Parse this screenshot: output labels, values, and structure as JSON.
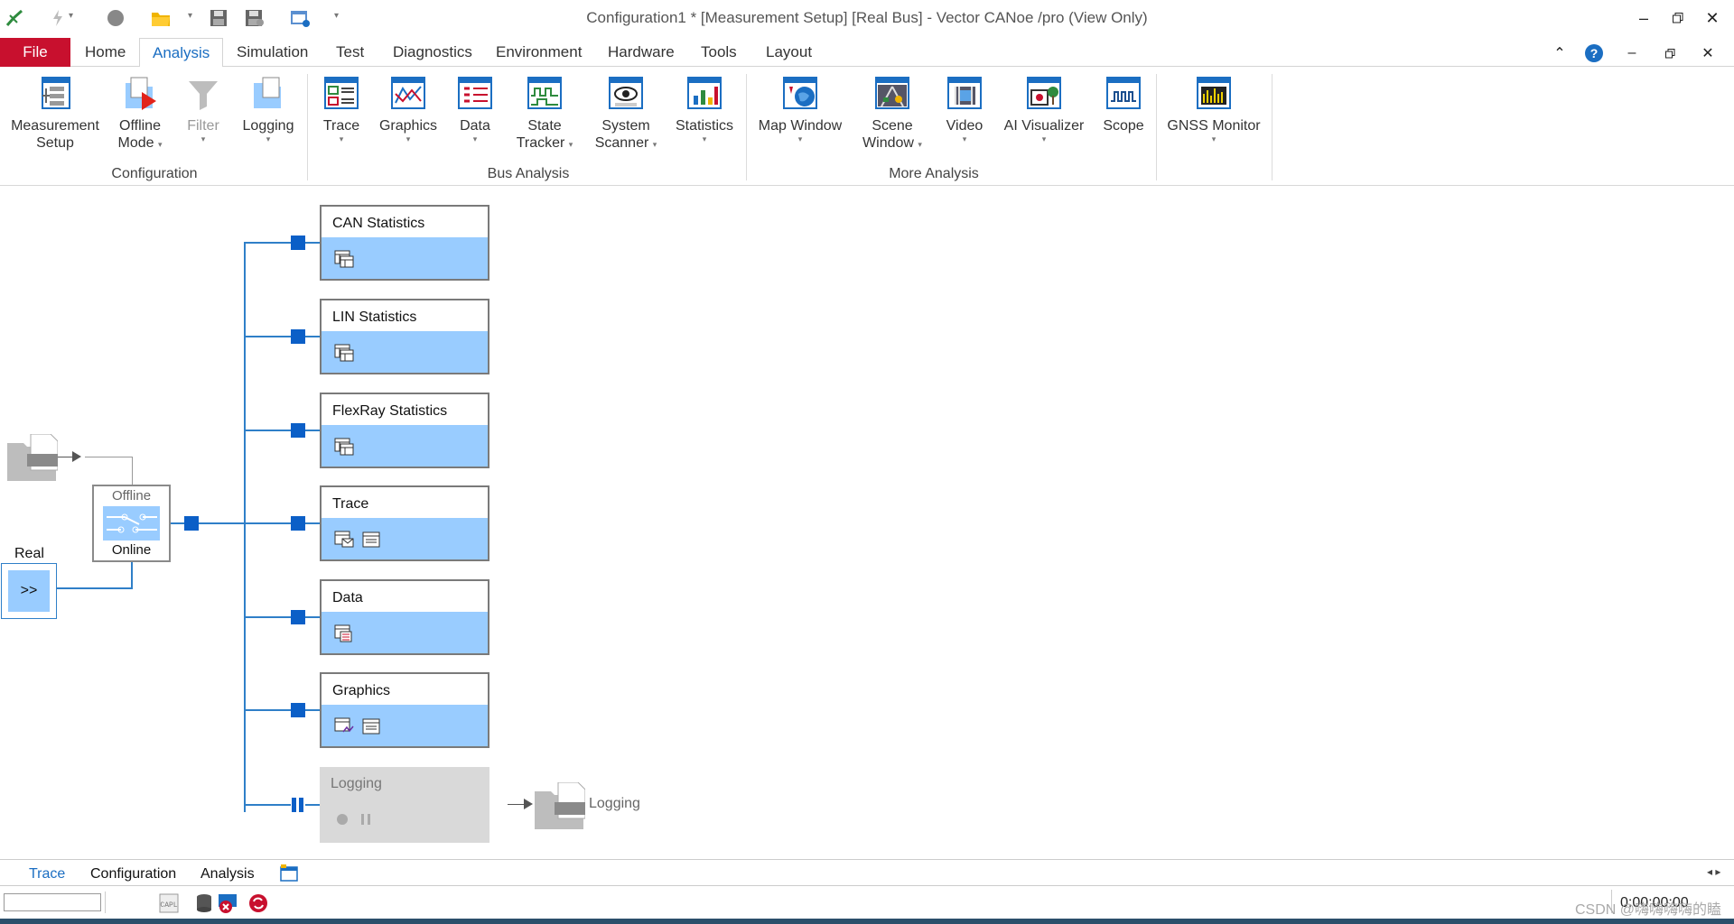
{
  "window": {
    "title": "Configuration1 * [Measurement Setup] [Real Bus] - Vector CANoe /pro (View Only)"
  },
  "quick_access": {
    "icons": [
      "canoe-logo-icon",
      "start-icon",
      "stop-icon",
      "open-folder-icon",
      "save-icon",
      "save-as-icon",
      "options-icon"
    ]
  },
  "ribbon_tabs": {
    "file": "File",
    "home": "Home",
    "analysis": "Analysis",
    "simulation": "Simulation",
    "test": "Test",
    "diagnostics": "Diagnostics",
    "environment": "Environment",
    "hardware": "Hardware",
    "tools": "Tools",
    "layout": "Layout"
  },
  "ribbon": {
    "measurement_setup": [
      "Measurement",
      "Setup"
    ],
    "offline_mode": [
      "Offline",
      "Mode"
    ],
    "filter": "Filter",
    "logging": "Logging",
    "trace": "Trace",
    "graphics": "Graphics",
    "data": "Data",
    "state_tracker": [
      "State",
      "Tracker"
    ],
    "system_scanner": [
      "System",
      "Scanner"
    ],
    "statistics": "Statistics",
    "map_window": "Map Window",
    "scene_window": [
      "Scene",
      "Window"
    ],
    "video": "Video",
    "ai_visualizer": "AI Visualizer",
    "scope": "Scope",
    "gnss_monitor": "GNSS Monitor",
    "groups": {
      "configuration": "Configuration",
      "bus_analysis": "Bus Analysis",
      "more_analysis": "More Analysis"
    }
  },
  "canvas": {
    "offline_switch_top": "Offline",
    "offline_switch_bottom": "Online",
    "real_label": "Real",
    "real_button": ">>",
    "blocks": {
      "can_statistics": "CAN Statistics",
      "lin_statistics": "LIN Statistics",
      "flexray_statistics": "FlexRay Statistics",
      "trace": "Trace",
      "data": "Data",
      "graphics": "Graphics",
      "logging": "Logging"
    },
    "logging_output": "Logging"
  },
  "bottom_tabs": {
    "trace": "Trace",
    "configuration": "Configuration",
    "analysis": "Analysis"
  },
  "status": {
    "time": "0:00:00:00",
    "watermark": "CSDN @嗨嗨嗨嗨的瞌"
  },
  "colors": {
    "file_tab": "#c8102e",
    "accent": "#1b6ec2",
    "block_body": "#99ccff",
    "connector": "#0b5fc7"
  }
}
